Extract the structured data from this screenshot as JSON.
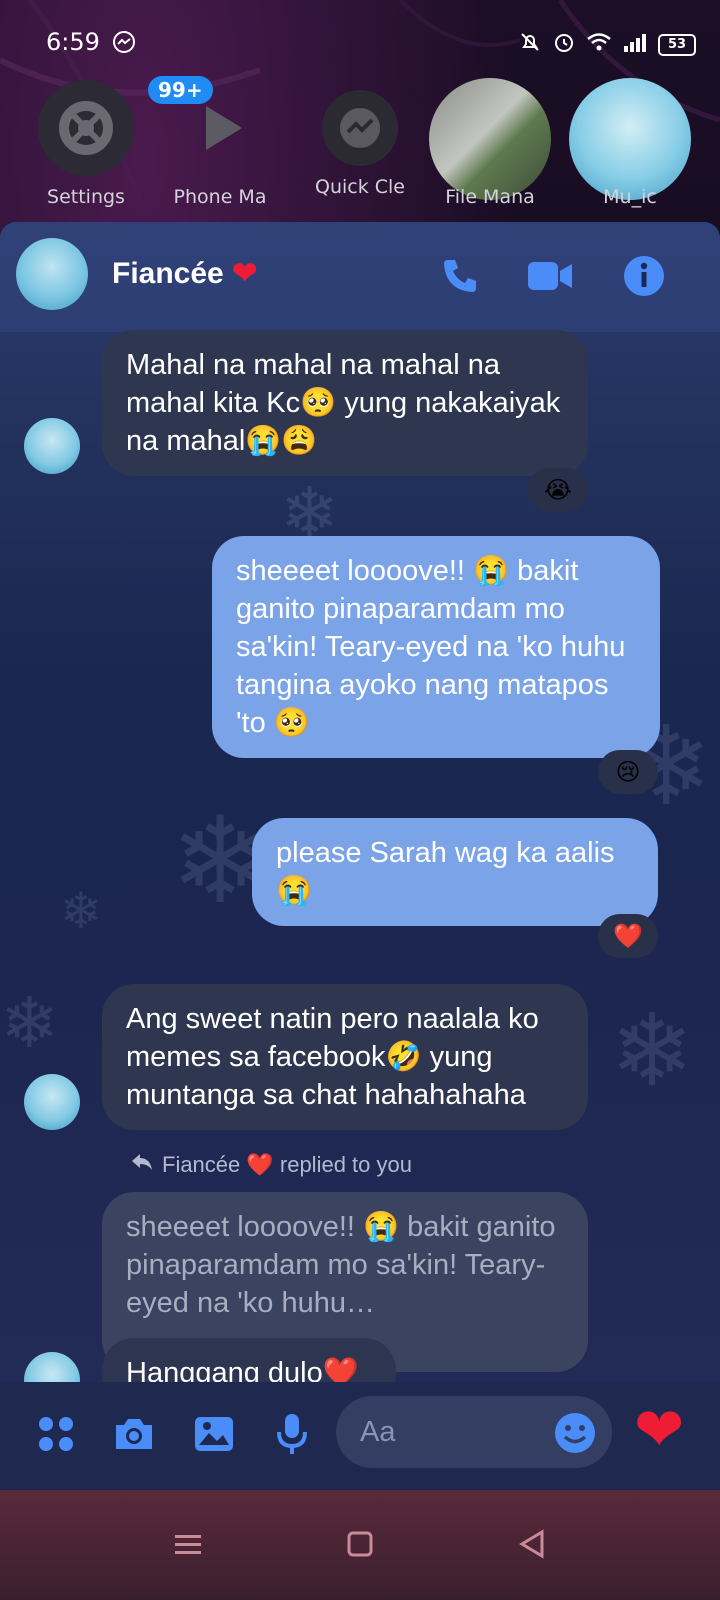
{
  "status_bar": {
    "time": "6:59",
    "battery": "53",
    "icons": [
      "messenger-icon",
      "mute-icon",
      "alarm-icon",
      "wifi-icon",
      "signal-icon",
      "battery-icon"
    ]
  },
  "launcher": {
    "badge": "99+",
    "items": [
      {
        "label": "Settings",
        "icon": "gear-icon"
      },
      {
        "label": "Phone Ma",
        "icon": "play-icon"
      },
      {
        "label": "Quick Cle",
        "icon": "messenger-icon"
      },
      {
        "label": "File Mana",
        "icon": "gallery-thumbnail"
      },
      {
        "label": "Mu_ic",
        "icon": "photo-thumbnail"
      }
    ]
  },
  "chat": {
    "contact_name": "Fiancée",
    "messages": [
      {
        "from": "them",
        "text": "Mahal na mahal na mahal na mahal kita Kc🥺 yung nakakaiyak na mahal😭😩",
        "reaction": "😭"
      },
      {
        "from": "me",
        "text": "sheeeet loooove!! 😭 bakit ganito pinaparamdam mo sa'kin! Teary-eyed na 'ko huhu tangina ayoko nang matapos 'to 🥺",
        "reaction": "😢"
      },
      {
        "from": "me",
        "text": "please Sarah wag ka aalis 😭",
        "reaction": "❤️"
      },
      {
        "from": "them",
        "text": "Ang sweet natin pero naalala ko memes sa facebook🤣 yung muntanga sa chat hahahahaha"
      },
      {
        "from": "them",
        "reply_note": "Fiancée ❤️ replied to you",
        "quoted": "sheeeet loooove!! 😭 bakit ganito pinaparamdam mo sa'kin! Teary-eyed na 'ko huhu…",
        "text": "Hanggang dulo❤️"
      }
    ]
  },
  "composer": {
    "placeholder": "Aa"
  },
  "colors": {
    "outgoing_bubble": "#7aa3e8",
    "incoming_bubble": "#2f3650",
    "accent": "#4b8df8",
    "heart": "#ef1c35"
  }
}
